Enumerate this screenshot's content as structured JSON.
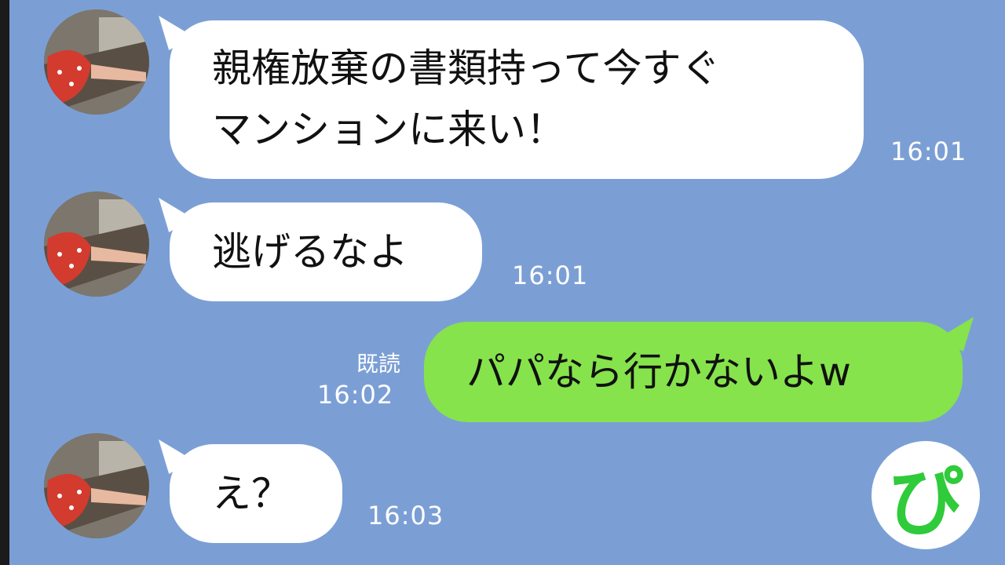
{
  "messages": [
    {
      "sender": "partner",
      "lines": [
        "親権放棄の書類持って今すぐ",
        "マンションに来い！"
      ],
      "time": "16:01"
    },
    {
      "sender": "partner",
      "lines": [
        "逃げるなよ"
      ],
      "time": "16:01"
    },
    {
      "sender": "me",
      "lines": [
        "パパなら行かないよw"
      ],
      "read": "既読",
      "time": "16:02"
    },
    {
      "sender": "partner",
      "lines": [
        "え？"
      ],
      "time": "16:03"
    }
  ],
  "logo": "ぴ",
  "colors": {
    "background": "#7b9fd5",
    "incoming_bubble": "#ffffff",
    "outgoing_bubble": "#86e34c",
    "logo_green": "#2fcb3b"
  },
  "icons": {
    "avatar": "avatar-photo",
    "logo": "pi-logo-icon"
  }
}
